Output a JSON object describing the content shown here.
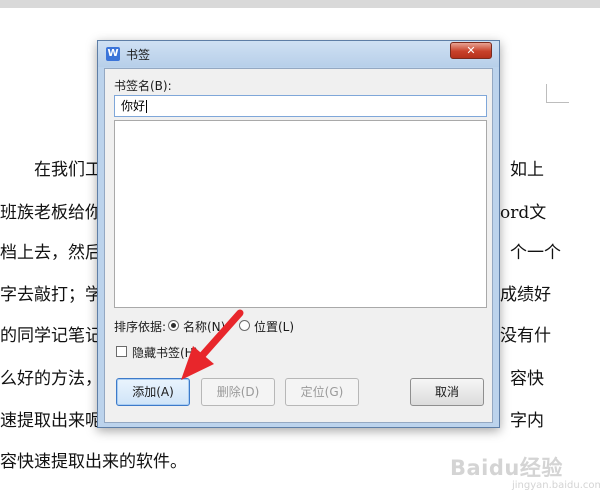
{
  "document": {
    "lines": [
      "在我们工",
      "如上",
      "班族老板给你",
      "ord文",
      "档上去，然后",
      "个一个",
      "字去敲打；学",
      "成绩好",
      "的同学记笔记",
      "没有什",
      "么好的方法，",
      "容快",
      "速提取出来呢",
      "字内",
      "容快速提取出来的软件。"
    ]
  },
  "watermark": {
    "brand": "Baidu经验",
    "url": "jingyan.baidu.com"
  },
  "dialog": {
    "title": "书签",
    "app_icon_letter": "W",
    "close_glyph": "✕",
    "name_label": "书签名(B):",
    "name_value": "你好",
    "sort_label": "排序依据:",
    "sort_options": [
      {
        "label": "名称(N)",
        "checked": true
      },
      {
        "label": "位置(L)",
        "checked": false
      }
    ],
    "hide_checkbox_label": "隐藏书签(H)",
    "hide_checked": false,
    "buttons": {
      "add": "添加(A)",
      "delete": "删除(D)",
      "locate": "定位(G)",
      "cancel": "取消"
    }
  },
  "annotation": {
    "arrow_color": "#e8262b"
  }
}
